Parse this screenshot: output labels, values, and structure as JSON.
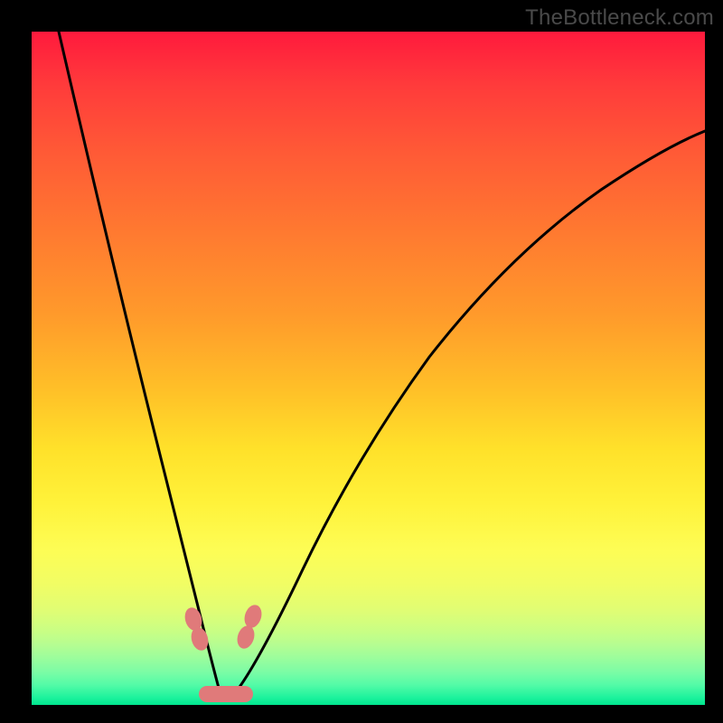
{
  "watermark": "TheBottleneck.com",
  "colors": {
    "background": "#000000",
    "gradient_top": "#ff1a3d",
    "gradient_mid": "#ffe12a",
    "gradient_bottom": "#00e58e",
    "curve": "#000000",
    "blob": "#e07a7a"
  },
  "chart_data": {
    "type": "line",
    "title": "",
    "xlabel": "",
    "ylabel": "",
    "xlim": [
      0,
      100
    ],
    "ylim": [
      0,
      100
    ],
    "grid": false,
    "series": [
      {
        "name": "left-branch",
        "x": [
          4,
          6,
          8,
          10,
          12,
          14,
          16,
          18,
          20,
          22,
          24,
          25.5,
          27
        ],
        "y": [
          100,
          82,
          66,
          53,
          42,
          33,
          25,
          18,
          12,
          7,
          3,
          1,
          0
        ]
      },
      {
        "name": "right-branch",
        "x": [
          30,
          32,
          35,
          38,
          42,
          46,
          50,
          55,
          60,
          66,
          72,
          79,
          86,
          93,
          100
        ],
        "y": [
          0,
          2,
          7,
          13,
          21,
          29,
          37,
          45,
          52,
          59,
          65,
          71,
          76,
          80,
          84
        ]
      }
    ],
    "annotations": [
      {
        "name": "blob-left-upper",
        "x": 23.8,
        "y": 11,
        "shape": "oval"
      },
      {
        "name": "blob-left-lower",
        "x": 23.8,
        "y": 8,
        "shape": "oval"
      },
      {
        "name": "blob-right-upper",
        "x": 31.5,
        "y": 12,
        "shape": "oval"
      },
      {
        "name": "blob-right-lower",
        "x": 31.5,
        "y": 9,
        "shape": "oval"
      },
      {
        "name": "blob-bottom",
        "x": 28,
        "y": 0,
        "shape": "capsule"
      }
    ]
  }
}
